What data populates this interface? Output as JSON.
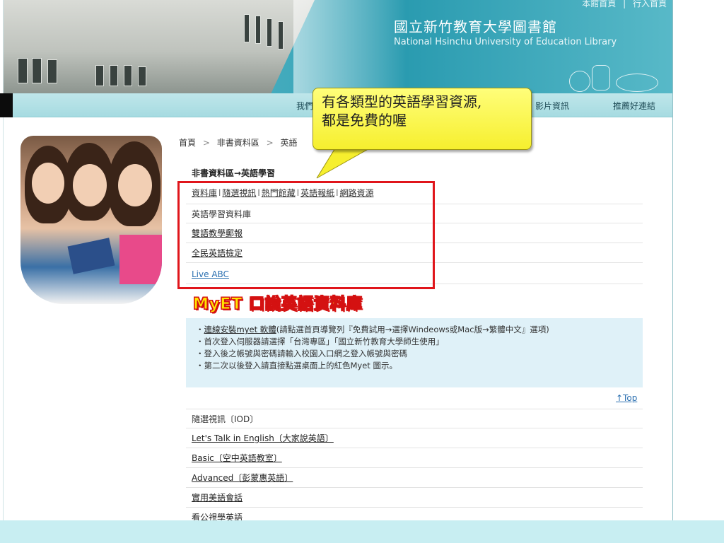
{
  "header": {
    "top_links": [
      "本館首頁",
      "|",
      "行入首頁"
    ],
    "title": "國立新竹教育大學圖書館",
    "subtitle": "National Hsinchu University of Education Library"
  },
  "nav": {
    "items": [
      "我們",
      "影片資訊",
      "推薦好連結"
    ]
  },
  "callout": {
    "line1": "有各類型的英語學習資源,",
    "line2": "都是免費的喔"
  },
  "breadcrumb": [
    "首頁",
    ">",
    "非書資料區",
    ">",
    "英語"
  ],
  "section_title": "非書資料區→英語學習",
  "tabs": [
    "資料庫",
    "隨選視訊",
    "熱門館藏",
    "英語報紙",
    "網路資源"
  ],
  "tab_separator": "l",
  "db_list": {
    "header": "英語學習資料庫",
    "items": [
      "雙語教學郵報",
      "全民英語檢定",
      "Live ABC"
    ]
  },
  "myet": {
    "banner": "MyET 口說英語資料庫",
    "install_link": "連線安裝myet 軟體",
    "lines": [
      "(請點選首頁導覽列『免費試用→選擇Windeows或Mac版→繁體中文』選項)",
      "首次登入伺服器請選擇「台灣專區」「國立新竹教育大學師生使用」",
      "登入後之帳號與密碼請輸入校園入口網之登入帳號與密碼",
      "第二次以後登入請直接點選桌面上的紅色Myet 圖示。"
    ]
  },
  "top_link": "↑Top",
  "iod": {
    "header": "隨選視訊〔IOD〕",
    "items": [
      "Let's Talk in English〔大家說英語〕",
      "Basic〔空中英語教室〕",
      "Advanced〔彭蒙惠英語〕",
      "實用美語會話",
      "看公視學英語"
    ]
  },
  "colors": {
    "header_teal": "#3ea8bb",
    "nav_light": "#a6dbe1",
    "highlight_red": "#e0151b",
    "callout_yellow": "#f6ef2e",
    "info_bg": "#dff1f8"
  }
}
